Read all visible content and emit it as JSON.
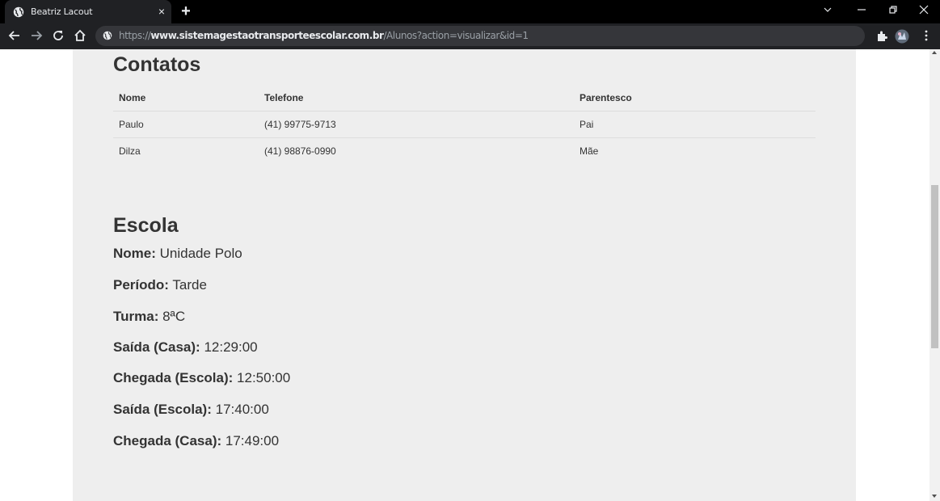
{
  "browser": {
    "tab_title": "Beatriz Lacout",
    "tab_close": "×",
    "new_tab": "+",
    "url_scheme": "https://",
    "url_host": "www.sistemagestaotransporteescolar.com.br",
    "url_rest": "/Alunos?action=visualizar&id=1"
  },
  "contacts": {
    "heading": "Contatos",
    "columns": [
      "Nome",
      "Telefone",
      "Parentesco"
    ],
    "rows": [
      [
        "Paulo",
        "(41) 99775-9713",
        "Pai"
      ],
      [
        "Dilza",
        "(41) 98876-0990",
        "Mãe"
      ]
    ]
  },
  "school": {
    "heading": "Escola",
    "fields": [
      {
        "label": "Nome:",
        "value": "Unidade Polo"
      },
      {
        "label": "Período:",
        "value": "Tarde"
      },
      {
        "label": "Turma:",
        "value": "8ªC"
      },
      {
        "label": "Saída (Casa):",
        "value": "12:29:00"
      },
      {
        "label": "Chegada (Escola):",
        "value": "12:50:00"
      },
      {
        "label": "Saída (Escola):",
        "value": "17:40:00"
      },
      {
        "label": "Chegada (Casa):",
        "value": "17:49:00"
      }
    ]
  }
}
